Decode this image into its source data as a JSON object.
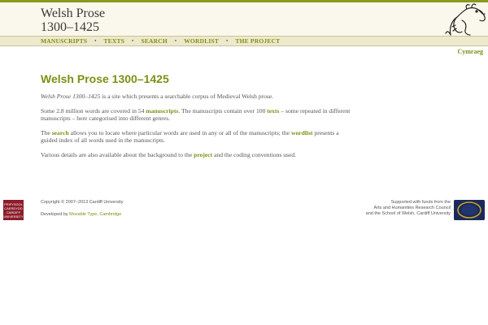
{
  "site": {
    "title_line1": "Welsh Prose",
    "title_line2": "1300–1425",
    "mascot_icon": "dragon-icon"
  },
  "nav": {
    "items": [
      "MANUSCRIPTS",
      "TEXTS",
      "SEARCH",
      "WORDLIST",
      "THE PROJECT"
    ],
    "separator": "•"
  },
  "lang_switch": "Cymraeg",
  "main": {
    "heading": "Welsh Prose 1300–1425",
    "p1_italic": "Welsh Prose 1300–1425",
    "p1_rest": " is a site which presents a searchable corpus of Medieval Welsh prose.",
    "p2_a": "Some 2.8 million words are covered in 54 ",
    "p2_link1": "manuscripts",
    "p2_b": ". The manuscripts contain over 100 ",
    "p2_link2": "texts",
    "p2_c": " – some repeated in different manuscripts – here categorised into different genres.",
    "p3_a": "The ",
    "p3_link1": "search",
    "p3_b": " allows you to locate where particular words are used in any or all of the manuscripts; the ",
    "p3_link2": "wordlist",
    "p3_c": " presents a guided index of all words used in the manuscripts.",
    "p4_a": "Various details are also available about the background to the ",
    "p4_link": "project",
    "p4_b": " and the coding conventions used."
  },
  "footer": {
    "logo_lines": [
      "PRIFYSGOL",
      "CAERDYDD",
      "CARDIFF",
      "UNIVERSITY"
    ],
    "copyright": "Copyright © 2007–2013 Cardiff University",
    "developed_prefix": "Developed by ",
    "developer_link": "Movable Type, Cambridge",
    "support_line1": "Supported with funds from the",
    "support_line2": "Arts and Humanities Research Council",
    "support_line3": "and the School of Welsh, Cardiff University",
    "ahrc_icon": "ahrc-logo-icon"
  },
  "colors": {
    "accent": "#7d8f14",
    "topbar": "#8a9a1f",
    "header_bg": "#faf8ec",
    "nav_bg": "#ece9cc",
    "logo_red": "#8c1d2b",
    "ahrc_blue": "#1a2a5a"
  }
}
